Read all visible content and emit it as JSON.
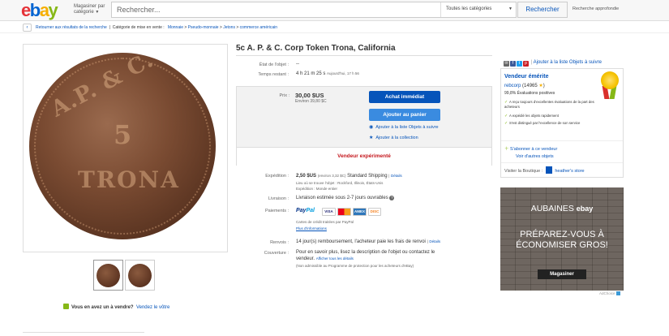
{
  "header": {
    "logo": {
      "e": "e",
      "b": "b",
      "a": "a",
      "y": "y"
    },
    "shop_by": "Magasiner par catégorie",
    "search_placeholder": "Rechercher...",
    "category": "Toutes les catégories",
    "search_button": "Rechercher",
    "advanced": "Recherche approfondie"
  },
  "breadcrumb": {
    "back": "Retourner aux résultats de la recherche",
    "sep": "|",
    "category_prefix": "Catégorie de mise en vente :",
    "path": [
      "Monnaie",
      "Pseudo-monnaie",
      "Jetons",
      "commerce américain"
    ]
  },
  "coin": {
    "top_text": "A.P. & C. CORP",
    "middle": "5",
    "bottom_text": "TRONA"
  },
  "listing": {
    "title": "5c A. P. & C. Corp Token Trona, California",
    "condition_label": "État de l'objet :",
    "condition_value": "--",
    "time_label": "Temps restant :",
    "time_value": "4 h 21 m 25 s",
    "time_detail": "Aujourd'hui, 17 h 56",
    "price_label": "Prix :",
    "price": "30,00 $US",
    "price_approx": "Environ 39,80 $C",
    "buy_now": "Achat immédiat",
    "add_to_cart": "Ajouter au panier",
    "watch": "Ajouter à la liste Objets à suivre",
    "collection": "Ajouter à la collection",
    "seller_tier": "Vendeur expérimenté",
    "shipping_label": "Expédition :",
    "shipping_value": "2,50 $US",
    "shipping_approx": "(environ 3,32 $C)",
    "shipping_method": "Standard Shipping",
    "details_link": "Détails",
    "location": "Lieu où se trouve l'objet : Rockford, Illinois, États-Unis",
    "ships_to": "Expédition : Monde entier",
    "delivery_label": "Livraison :",
    "delivery_value": "Livraison estimée sous 2-7 jours ouvrables",
    "payments_label": "Paiements :",
    "paypal_a": "Pay",
    "paypal_b": "Pal",
    "cards": [
      "VISA",
      "MC",
      "AMEX",
      "DISC"
    ],
    "credit_note": "Cartes de crédit traitées par PayPal",
    "more_info": "Plus d'informations",
    "returns_label": "Renvois :",
    "returns_value": "14 jour(s) remboursement, l'acheteur paie les frais de renvoi",
    "returns_sep": "|",
    "returns_details": "Détails",
    "coverage_label": "Couverture :",
    "coverage_line1": "Pour en savoir plus, lisez la description de l'objet ou contactez le",
    "coverage_line2": "vendeur.",
    "coverage_line2_link": "Afficher tous les détails",
    "coverage_line3": "(Non admissible au Programme de protection pour les acheteurs d'eBay)"
  },
  "seller": {
    "share_link": "Ajouter à la liste Objets à suivre",
    "share_sep": "|",
    "top_rated": "Vendeur émérite",
    "name": "rebcorp",
    "count": "(14965",
    "count_close": ")",
    "feedback": "99,8% Évaluations positives",
    "checks": [
      "A reçu toujours d'excellentes évaluations de la part des acheteurs",
      "A expédié les objets rapidement",
      "S'est distingué par l'excellence de son service"
    ],
    "follow": "S'abonner à ce vendeur",
    "other_items": "Voir d'autres objets",
    "visit": "Visiter la Boutique :",
    "store": "heather's store"
  },
  "ad": {
    "headline": "AUBAINES",
    "brand": "ebay",
    "tagline": "PRÉPAREZ-VOUS À ÉCONOMISER GROS!",
    "button": "Magasiner",
    "adchoices": "AdChoice"
  },
  "footer": {
    "sell_question": "Vous en avez un à vendre?",
    "sell_link": "Vendez le vôtre"
  }
}
